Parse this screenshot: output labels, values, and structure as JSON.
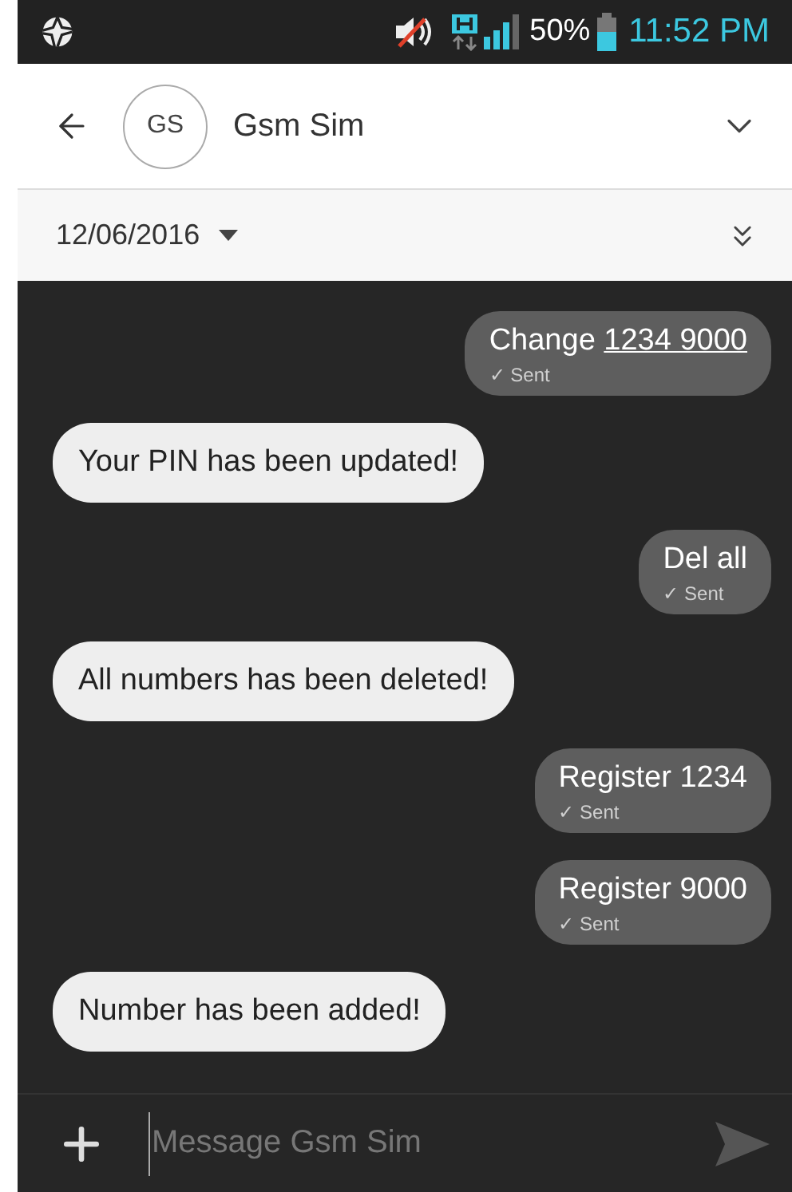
{
  "status_bar": {
    "battery": "50%",
    "time": "11:52 PM"
  },
  "header": {
    "avatar": "GS",
    "title": "Gsm Sim"
  },
  "date_bar": {
    "date": "12/06/2016"
  },
  "messages": [
    {
      "kind": "outgoing",
      "text": "Change",
      "link": "1234 9000",
      "status": "✓ Sent"
    },
    {
      "kind": "incoming",
      "text": "Your PIN has been updated!"
    },
    {
      "kind": "outgoing",
      "text": "Del all",
      "status": "✓ Sent"
    },
    {
      "kind": "incoming",
      "text": "All numbers has been deleted!"
    },
    {
      "kind": "outgoing",
      "text": "Register 1234",
      "status": "✓ Sent"
    },
    {
      "kind": "outgoing",
      "text": "Register 9000",
      "status": "✓ Sent"
    },
    {
      "kind": "incoming",
      "text": "Number has been added!"
    }
  ],
  "composer": {
    "placeholder": "Message Gsm Sim"
  }
}
